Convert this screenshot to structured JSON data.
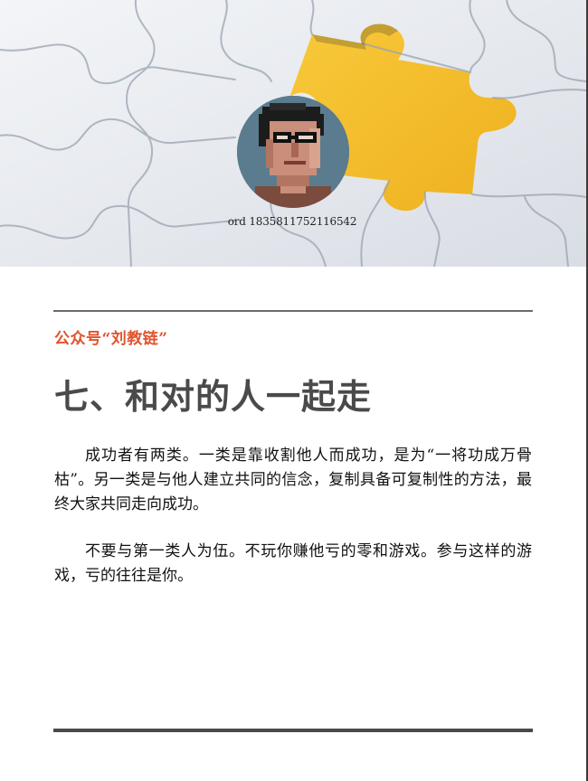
{
  "hero": {
    "image": "jigsaw-puzzle-photo",
    "avatar": "pixel-portrait-glasses",
    "caption": "ord 18358117521165​42",
    "colors": {
      "puzzle_white": "#eef0f4",
      "puzzle_gold": "#f4be2c",
      "avatar_bg": "#5a7a8c"
    }
  },
  "article": {
    "source": "公众号“刘教链”",
    "title": "七、和对的人一起走",
    "paragraphs": [
      "成功者有两类。一类是靠收割他人而成功，是为“一将功成万骨枯”。另一类是与他人建立共同的信念，复制具备可复制性的方法，最终大家共同走向成功。",
      "不要与第一类人为伍。不玩你赚他亏的零和游戏。参与这样的游戏，亏的往往是你。"
    ],
    "accent_color": "#e0542e"
  }
}
